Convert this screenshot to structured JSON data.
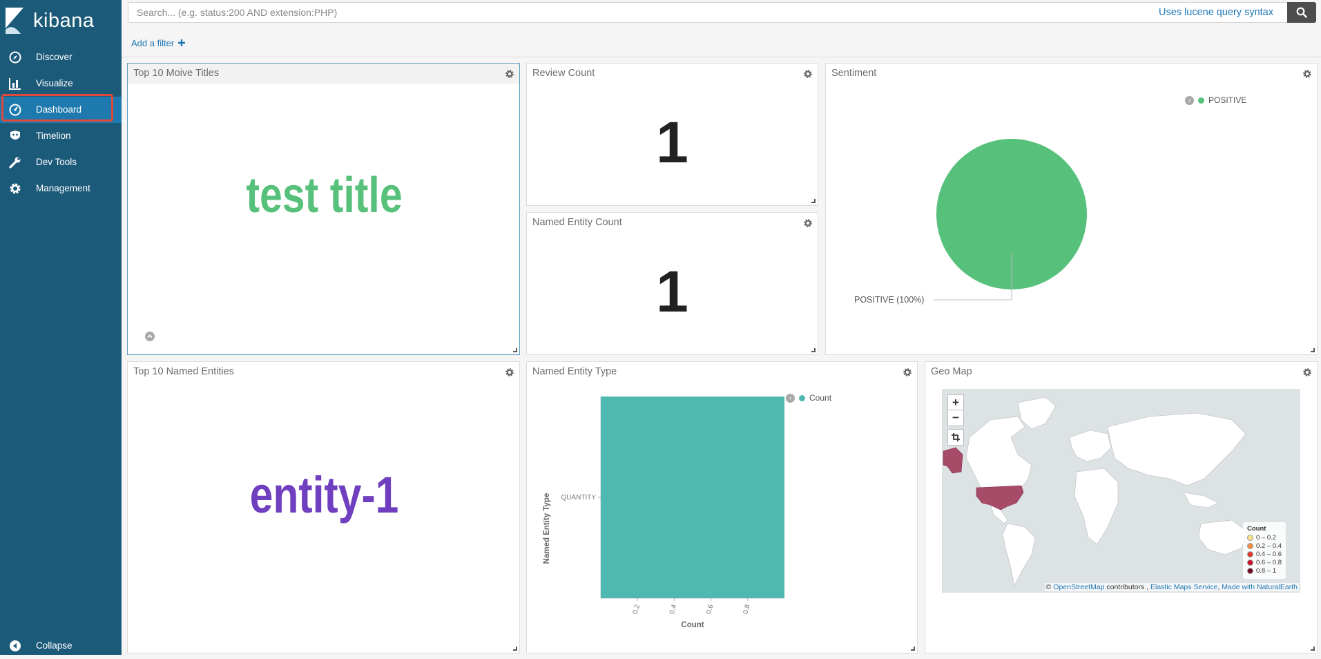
{
  "app": {
    "name": "kibana"
  },
  "sidebar": {
    "items": [
      {
        "label": "Discover",
        "icon": "compass-icon"
      },
      {
        "label": "Visualize",
        "icon": "bar-chart-icon"
      },
      {
        "label": "Dashboard",
        "icon": "dashboard-icon",
        "active": true
      },
      {
        "label": "Timelion",
        "icon": "timelion-icon"
      },
      {
        "label": "Dev Tools",
        "icon": "wrench-icon"
      },
      {
        "label": "Management",
        "icon": "gear-icon"
      }
    ],
    "collapse_label": "Collapse"
  },
  "search": {
    "placeholder": "Search... (e.g. status:200 AND extension:PHP)",
    "syntax_link": "Uses lucene query syntax"
  },
  "filter": {
    "add_label": "Add a filter"
  },
  "panels": {
    "movie_titles": {
      "title": "Top 10 Moive Titles",
      "word": "test title",
      "word_color": "#57c17b"
    },
    "review_count": {
      "title": "Review Count",
      "value": "1"
    },
    "entity_count": {
      "title": "Named Entity Count",
      "value": "1"
    },
    "sentiment": {
      "title": "Sentiment",
      "legend": "POSITIVE",
      "slice_label": "POSITIVE (100%)",
      "color": "#57c17b"
    },
    "named_entities": {
      "title": "Top 10 Named Entities",
      "word": "entity-1",
      "word_color": "#6f3fbf"
    },
    "entity_type": {
      "title": "Named Entity Type",
      "legend": "Count",
      "color": "#4fb9b1"
    },
    "geo_map": {
      "title": "Geo Map",
      "zoom_in": "+",
      "zoom_out": "−",
      "legend_title": "Count",
      "legend_rows": [
        {
          "label": "0 – 0.2",
          "color": "#fee08b"
        },
        {
          "label": "0.2 – 0.4",
          "color": "#f98c3f"
        },
        {
          "label": "0.4 – 0.6",
          "color": "#e2382b"
        },
        {
          "label": "0.6 – 0.8",
          "color": "#c3112a"
        },
        {
          "label": "0.8 – 1",
          "color": "#6d0a20"
        }
      ],
      "attribution": {
        "prefix": "©",
        "osm": "OpenStreetMap",
        "contributors": " contributors ,",
        "ems": "Elastic Maps Service",
        "sep": ",",
        "ne": "Made with NaturalEarth"
      }
    }
  },
  "chart_data": {
    "type": "bar",
    "orientation": "horizontal",
    "categories": [
      "QUANTITY"
    ],
    "series": [
      {
        "name": "Count",
        "values": [
          1
        ]
      }
    ],
    "xlabel": "Count",
    "ylabel": "Named Entity Type",
    "xticks": [
      "0.2",
      "0.4",
      "0.6",
      "0.8"
    ],
    "xlim": [
      0,
      1
    ]
  }
}
